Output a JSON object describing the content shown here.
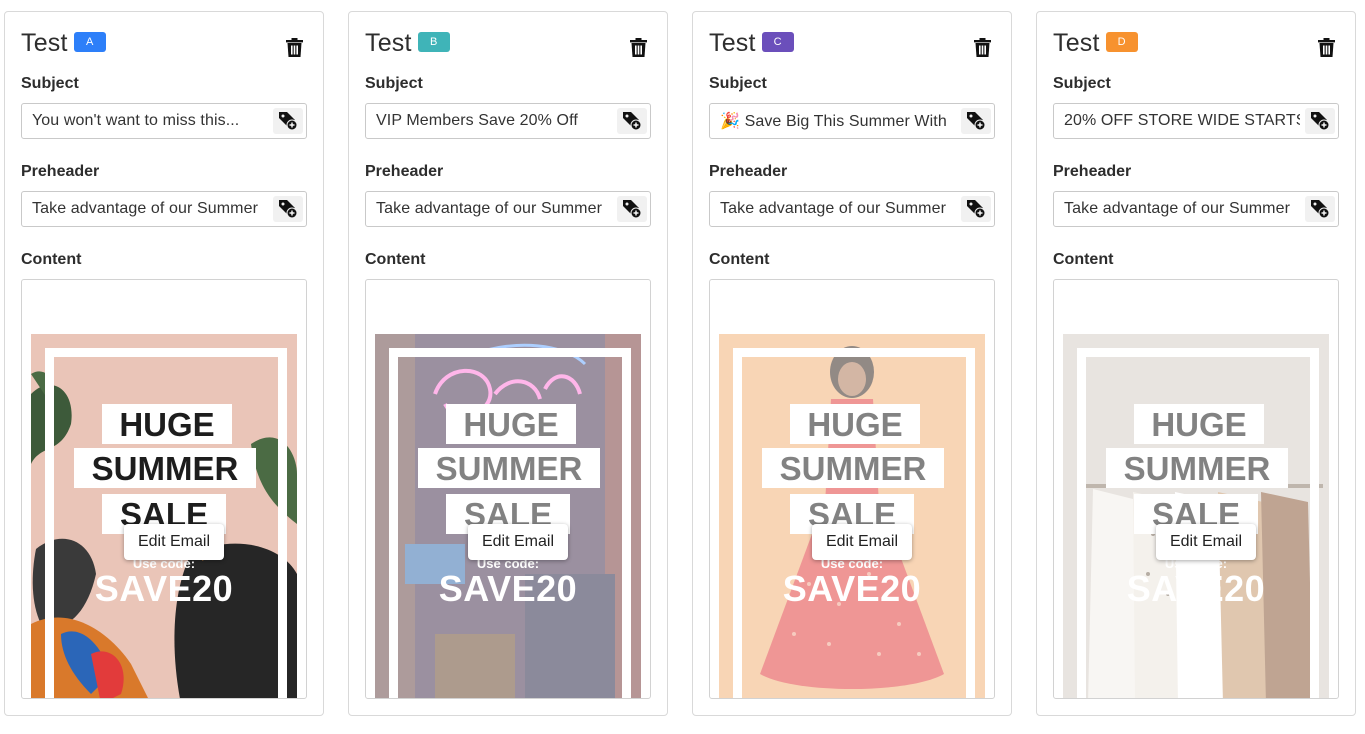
{
  "labels": {
    "subject": "Subject",
    "preheader": "Preheader",
    "content": "Content"
  },
  "variants": [
    {
      "title": "Test",
      "badge": "A",
      "badge_color": "#2d7ff9",
      "subject": "You won't want to miss this...",
      "preheader": "Take advantage of our Summer",
      "email": {
        "line1": "HUGE",
        "line2": "SUMMER",
        "line3": "SALE",
        "use_code": "Use code:",
        "code": "SAVE20",
        "edit_label": "Edit Email"
      }
    },
    {
      "title": "Test",
      "badge": "B",
      "badge_color": "#3fb4b8",
      "subject": "VIP Members Save 20% Off",
      "preheader": "Take advantage of our Summer",
      "email": {
        "line1": "HUGE",
        "line2": "SUMMER",
        "line3": "SALE",
        "use_code": "Use code:",
        "code": "SAVE20",
        "edit_label": "Edit Email"
      }
    },
    {
      "title": "Test",
      "badge": "C",
      "badge_color": "#6b4fbb",
      "subject": "🎉 Save Big This Summer With",
      "preheader": "Take advantage of our Summer",
      "email": {
        "line1": "HUGE",
        "line2": "SUMMER",
        "line3": "SALE",
        "use_code": "Use code:",
        "code": "SAVE20",
        "edit_label": "Edit Email"
      }
    },
    {
      "title": "Test",
      "badge": "D",
      "badge_color": "#f7922f",
      "subject": "20% OFF STORE WIDE STARTS",
      "preheader": "Take advantage of our Summer",
      "email": {
        "line1": "HUGE",
        "line2": "SUMMER",
        "line3": "SALE",
        "use_code": "Use code:",
        "code": "SAVE20",
        "edit_label": "Edit Email"
      }
    }
  ],
  "icons": {
    "delete": "trash-icon",
    "personalize": "tag-plus-icon"
  }
}
